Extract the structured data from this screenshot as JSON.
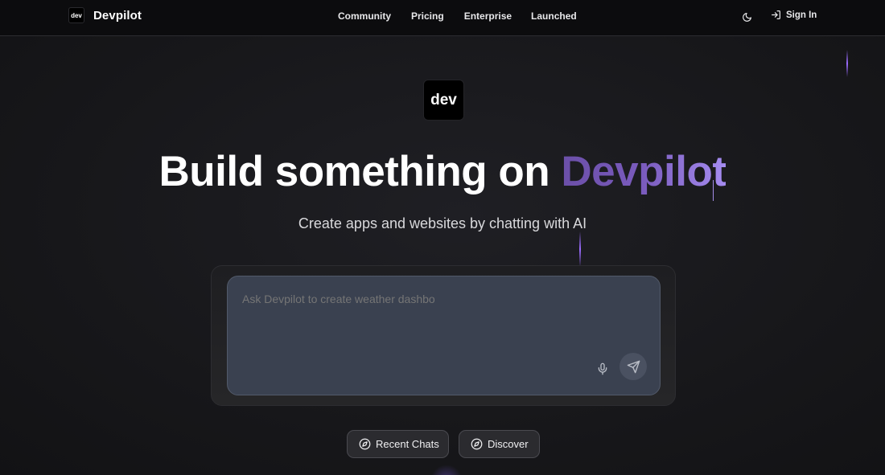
{
  "app": {
    "logo_text": "dev",
    "name": "Devpilot"
  },
  "nav": {
    "links": [
      "Community",
      "Pricing",
      "Enterprise",
      "Launched"
    ],
    "theme_icon": "moon-icon",
    "signin_icon": "sign-in-icon",
    "signin_label": "Sign In"
  },
  "hero": {
    "logo_text": "dev",
    "title_main": "Build something on ",
    "title_accent": "Devpilot",
    "subtitle": "Create apps and websites by chatting with AI"
  },
  "prompt": {
    "placeholder": "Ask Devpilot to create weather dashbo",
    "mic_icon": "microphone-icon",
    "send_icon": "send-icon"
  },
  "actions": {
    "recent_chats": "Recent Chats",
    "discover": "Discover",
    "icon": "compass-icon"
  },
  "colors": {
    "accent": "#7a5bbd",
    "background": "#121214",
    "prompt_box": "#3a4150"
  }
}
